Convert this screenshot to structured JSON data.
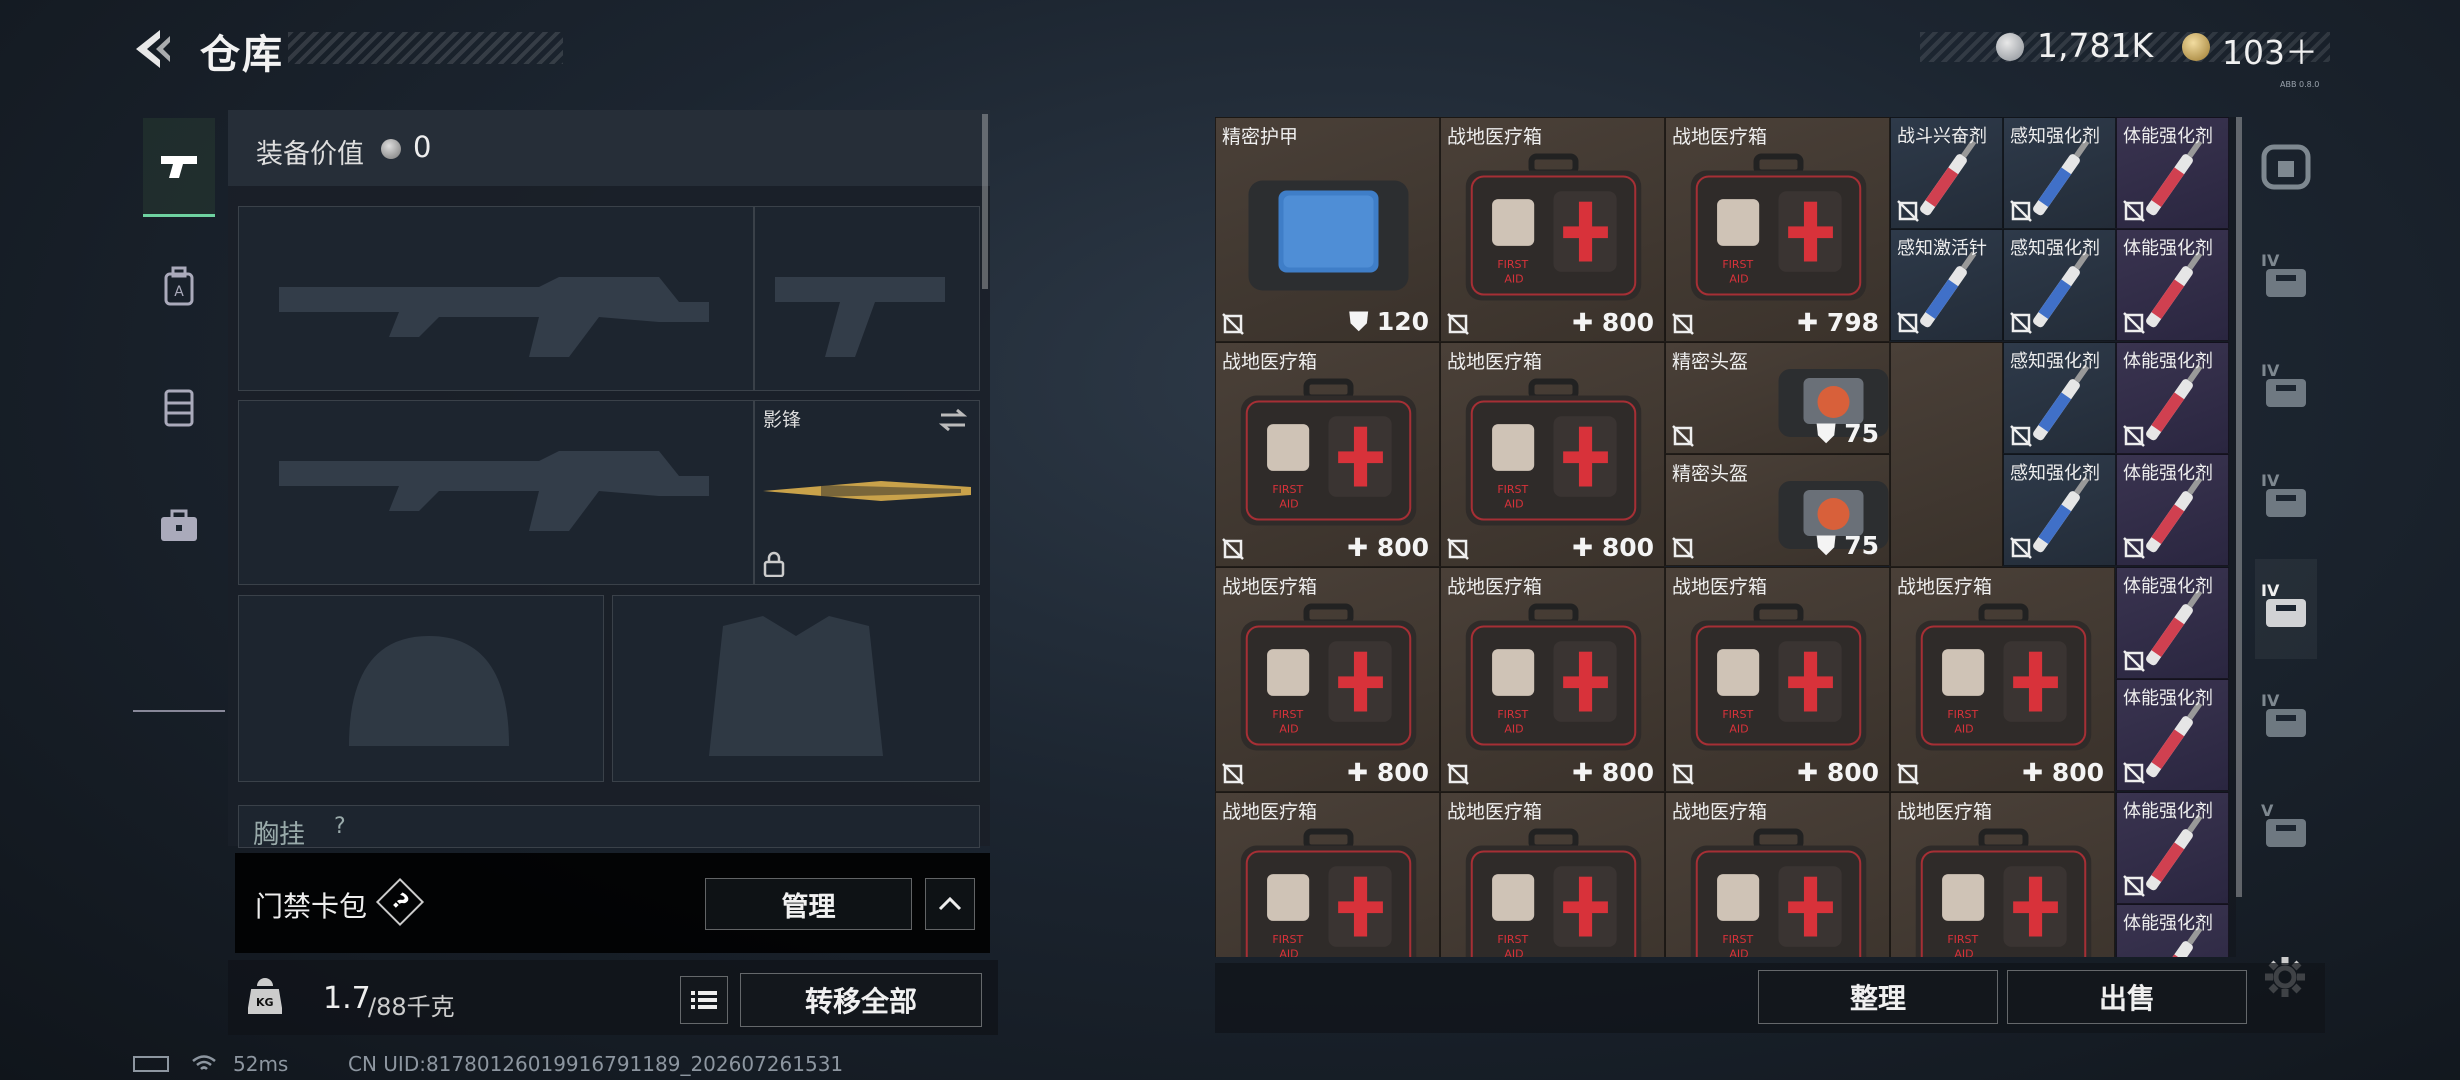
{
  "header": {
    "title": "仓库",
    "currency_1": "1,781K",
    "currency_2": "103＋",
    "version": "ABB 0.8.0"
  },
  "left_tabs": [
    "pistol-icon",
    "backpack-icon",
    "vest-icon",
    "toolbox-icon"
  ],
  "equipment": {
    "value_label": "装备价值",
    "value": "0",
    "melee_name": "影锋",
    "chest_label": "胸挂",
    "chest_hint": "?"
  },
  "key_bag": {
    "label": "门禁卡包",
    "help": "?",
    "manage_btn": "管理"
  },
  "footer": {
    "weight_current": "1.7",
    "weight_max": "/88千克",
    "weight_icon_text": "KG",
    "transfer_btn": "转移全部"
  },
  "grid": {
    "tiles": [
      {
        "name": "精密护甲",
        "value": "120",
        "stat": "armor"
      },
      {
        "name": "战地医疗箱",
        "value": "800",
        "stat": "heal"
      },
      {
        "name": "战地医疗箱",
        "value": "798",
        "stat": "heal"
      },
      {
        "name": "战斗兴奋剂",
        "value": "",
        "stat": ""
      },
      {
        "name": "感知强化剂",
        "value": "",
        "stat": ""
      },
      {
        "name": "体能强化剂",
        "value": "",
        "stat": ""
      },
      {
        "name": "感知激活针",
        "value": "",
        "stat": ""
      },
      {
        "name": "感知强化剂",
        "value": "",
        "stat": ""
      },
      {
        "name": "体能强化剂",
        "value": "",
        "stat": ""
      },
      {
        "name": "战地医疗箱",
        "value": "800",
        "stat": "heal"
      },
      {
        "name": "战地医疗箱",
        "value": "800",
        "stat": "heal"
      },
      {
        "name": "精密头盔",
        "value": "75",
        "stat": "armor"
      },
      {
        "name": "感知强化剂",
        "value": "",
        "stat": ""
      },
      {
        "name": "体能强化剂",
        "value": "",
        "stat": ""
      },
      {
        "name": "精密头盔",
        "value": "75",
        "stat": "armor"
      },
      {
        "name": "感知强化剂",
        "value": "",
        "stat": ""
      },
      {
        "name": "体能强化剂",
        "value": "",
        "stat": ""
      },
      {
        "name": "战地医疗箱",
        "value": "800",
        "stat": "heal"
      },
      {
        "name": "战地医疗箱",
        "value": "800",
        "stat": "heal"
      },
      {
        "name": "战地医疗箱",
        "value": "800",
        "stat": "heal"
      },
      {
        "name": "战地医疗箱",
        "value": "800",
        "stat": "heal"
      },
      {
        "name": "体能强化剂",
        "value": "",
        "stat": ""
      },
      {
        "name": "体能强化剂",
        "value": "",
        "stat": ""
      },
      {
        "name": "战地医疗箱",
        "value": "",
        "stat": ""
      },
      {
        "name": "战地医疗箱",
        "value": "",
        "stat": ""
      },
      {
        "name": "战地医疗箱",
        "value": "",
        "stat": ""
      },
      {
        "name": "战地医疗箱",
        "value": "",
        "stat": ""
      },
      {
        "name": "体能强化剂",
        "value": "",
        "stat": ""
      },
      {
        "name": "体能强化剂",
        "value": "",
        "stat": ""
      }
    ]
  },
  "right_tabs": [
    "safe-icon",
    "tier-IV-rifle-icon",
    "tier-IV-gun-icon",
    "tier-IV-folder-icon",
    "tier-IV-medkit-icon",
    "tier-IV-hand-icon",
    "tier-V-camera-icon"
  ],
  "right_tab_levels": [
    "",
    "IV",
    "IV",
    "IV",
    "IV",
    "IV",
    "V"
  ],
  "bottom_buttons": {
    "sort": "整理",
    "sell": "出售"
  },
  "status": {
    "ping": "52ms",
    "uid": "CN UID:81780126019916791189_202607261531"
  },
  "colors": {
    "accent_green": "#6ed2a0",
    "heal_red": "#d8323a",
    "stim_red": "#d04050",
    "stim_blue": "#4070c8"
  }
}
